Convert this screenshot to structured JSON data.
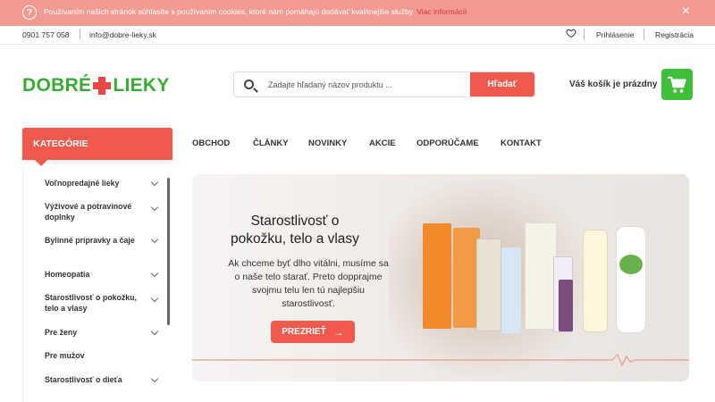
{
  "cookie_bar": {
    "icon": "question-circle-icon",
    "text": "Používaním našich stránok súhlasíte s používaním cookies, ktoré nám pomáhajú dodávať kvalitnejšie služby",
    "link": "Viac informácií",
    "close": "×",
    "color": "#f39a93"
  },
  "topbar": {
    "phone": "0901 757 058",
    "email": "info@dobre-lieky.sk",
    "login": "Prihlásenie",
    "register": "Registrácia"
  },
  "header": {
    "logo_left": "DOBRÉ",
    "logo_right": "LIEKY",
    "search_placeholder": "Zadajte hľadaný názov produktu ...",
    "search_button": "Hľadať",
    "cart_text": "Váš košík je prázdny"
  },
  "categories": {
    "title": "KATEGÓRIE",
    "items": [
      {
        "label": "Voľnopredajné lieky",
        "has_sub": true
      },
      {
        "label": "Výživové a potravinové doplnky",
        "has_sub": true
      },
      {
        "label": "Bylinné prípravky a čaje",
        "has_sub": true
      },
      {
        "label": "Homeopatia",
        "has_sub": true
      },
      {
        "label": "Starostlivosť o pokožku, telo a vlasy",
        "has_sub": true
      },
      {
        "label": "Pre ženy",
        "has_sub": true
      },
      {
        "label": "Pre mužov",
        "has_sub": false
      },
      {
        "label": "Starostlivosť o dieťa",
        "has_sub": true
      }
    ]
  },
  "nav": [
    "OBCHOD",
    "ČLÁNKY",
    "NOVINKY",
    "AKCIE",
    "ODPORÚČAME",
    "KONTAKT"
  ],
  "banner": {
    "title": "Starostlivosť o pokožku, telo a vlasy",
    "text": "Ak chceme byť dlho vitálni, musíme sa o naše telo starať. Preto dopprajme svojmu telu len tú najlepšiu starostlivosť.",
    "button": "PREZRIEŤ",
    "button_icon": "arrow-right-icon"
  },
  "colors": {
    "accent_red": "#ef5a4c",
    "brand_green": "#3aaa35",
    "cart_green": "#3fbf3a"
  }
}
